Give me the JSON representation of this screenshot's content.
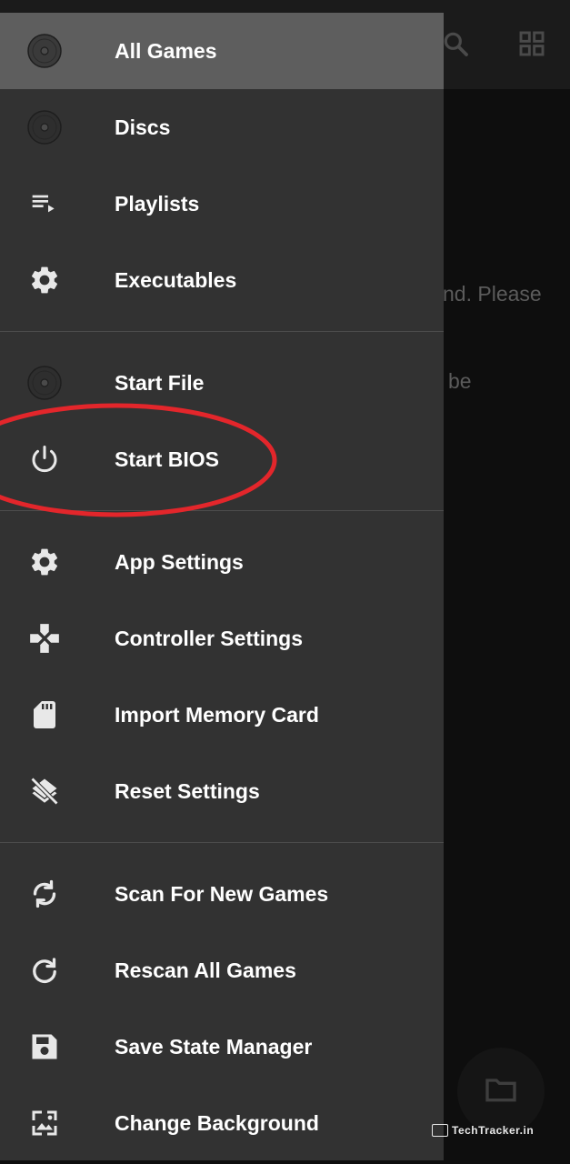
{
  "background": {
    "message_line1": "nd. Please",
    "message_line2": "be",
    "toolbar_icons": [
      "search-icon",
      "grid-view-icon"
    ],
    "fab_icon": "folder-icon"
  },
  "drawer": {
    "sections": [
      {
        "items": [
          {
            "label": "All Games",
            "icon": "disc-icon",
            "active": true
          },
          {
            "label": "Discs",
            "icon": "disc-icon",
            "active": false
          },
          {
            "label": "Playlists",
            "icon": "playlist-icon",
            "active": false
          },
          {
            "label": "Executables",
            "icon": "gear-icon",
            "active": false
          }
        ]
      },
      {
        "items": [
          {
            "label": "Start File",
            "icon": "disc-icon",
            "active": false
          },
          {
            "label": "Start BIOS",
            "icon": "power-icon",
            "active": false
          }
        ]
      },
      {
        "items": [
          {
            "label": "App Settings",
            "icon": "gear-icon",
            "active": false
          },
          {
            "label": "Controller Settings",
            "icon": "gamepad-icon",
            "active": false
          },
          {
            "label": "Import Memory Card",
            "icon": "sd-card-icon",
            "active": false
          },
          {
            "label": "Reset Settings",
            "icon": "layers-clear-icon",
            "active": false
          }
        ]
      },
      {
        "items": [
          {
            "label": "Scan For New Games",
            "icon": "sync-icon",
            "active": false
          },
          {
            "label": "Rescan All Games",
            "icon": "refresh-icon",
            "active": false
          },
          {
            "label": "Save State Manager",
            "icon": "save-icon",
            "active": false
          },
          {
            "label": "Change Background",
            "icon": "wallpaper-icon",
            "active": false
          }
        ]
      }
    ]
  },
  "annotation": {
    "color": "#e3262b",
    "target": "Start BIOS"
  },
  "watermark": {
    "text": "TechTracker.in"
  },
  "colors": {
    "drawer_bg": "#323232",
    "active_bg": "#5e5e5e",
    "icon": "#e8e8e8",
    "text": "#ffffff"
  }
}
